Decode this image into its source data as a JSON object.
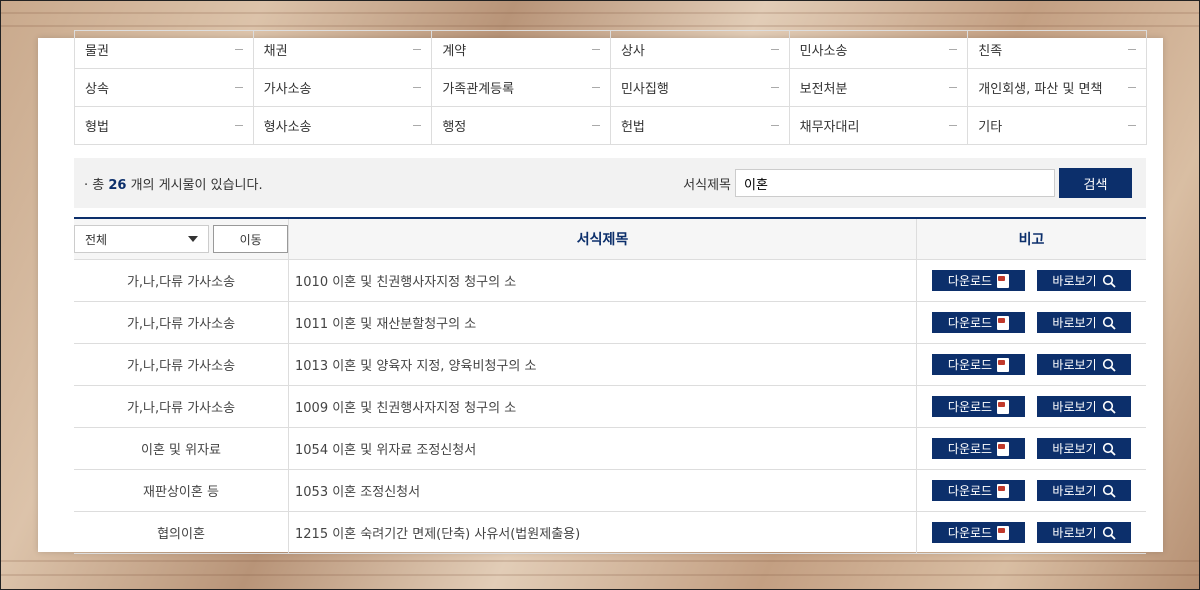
{
  "categories": [
    [
      "물권",
      "채권",
      "계약",
      "상사",
      "민사소송",
      "친족"
    ],
    [
      "상속",
      "가사소송",
      "가족관계등록",
      "민사집행",
      "보전처분",
      "개인회생, 파산 및 면책"
    ],
    [
      "형법",
      "형사소송",
      "행정",
      "헌법",
      "채무자대리",
      "기타"
    ]
  ],
  "summary": {
    "prefix": "· 총 ",
    "count": "26",
    "suffix": " 개의 게시물이 있습니다.",
    "search_label": "서식제목",
    "search_value": "이혼",
    "search_button": "검색"
  },
  "table": {
    "filter_selected": "전체",
    "move_button": "이동",
    "col_title": "서식제목",
    "col_note": "비고",
    "download_label": "다운로드",
    "view_label": "바로보기",
    "rows": [
      {
        "category": "가,나,다류 가사소송",
        "title": "1010 이혼 및 친권행사자지정 청구의 소"
      },
      {
        "category": "가,나,다류 가사소송",
        "title": "1011 이혼 및 재산분할청구의 소"
      },
      {
        "category": "가,나,다류 가사소송",
        "title": "1013 이혼 및 양육자 지정, 양육비청구의 소"
      },
      {
        "category": "가,나,다류 가사소송",
        "title": "1009 이혼 및 친권행사자지정 청구의 소"
      },
      {
        "category": "이혼 및 위자료",
        "title": "1054 이혼 및 위자료 조정신청서"
      },
      {
        "category": "재판상이혼 등",
        "title": "1053 이혼 조정신청서"
      },
      {
        "category": "협의이혼",
        "title": "1215 이혼 숙려기간 면제(단축) 사유서(법원제출용)"
      }
    ]
  },
  "colors": {
    "accent": "#0c2f6b",
    "icon_red": "#c0392b"
  }
}
